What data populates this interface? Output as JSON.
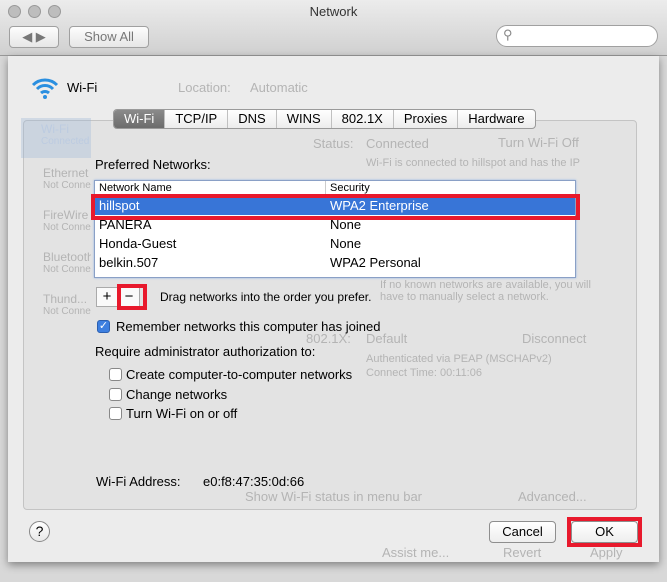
{
  "window": {
    "title": "Network",
    "show_all": "Show All",
    "search_placeholder": ""
  },
  "background": {
    "location_label": "Location:",
    "location_value": "Automatic",
    "status_label": "Status:",
    "status_value": "Connected",
    "turn_off": "Turn Wi-Fi Off",
    "status_desc": "Wi-Fi is connected to hillspot and has the IP",
    "eightoz_label": "802.1X:",
    "eightoz_value": "Default",
    "disconnect": "Disconnect",
    "auth": "Authenticated via PEAP (MSCHAPv2)",
    "connect_time": "Connect Time: 00:11:06",
    "known": "If no known networks are available, you will",
    "known2": "have to manually select a network.",
    "show_status": "Show Wi-Fi status in menu bar",
    "advanced": "Advanced...",
    "assist": "Assist me...",
    "revert": "Revert",
    "apply": "Apply",
    "services": [
      {
        "name": "Wi-Fi",
        "status": "Connected"
      },
      {
        "name": "Ethernet",
        "status": "Not Connected"
      },
      {
        "name": "FireWire",
        "status": "Not Connected"
      },
      {
        "name": "Bluetooth",
        "status": "Not Connected"
      },
      {
        "name": "Thund...",
        "status": "Not Connected"
      }
    ]
  },
  "sheet": {
    "header": "Wi-Fi",
    "tabs": [
      "Wi-Fi",
      "TCP/IP",
      "DNS",
      "WINS",
      "802.1X",
      "Proxies",
      "Hardware"
    ],
    "selected_tab": "Wi-Fi",
    "preferred_label": "Preferred Networks:",
    "columns": [
      "Network Name",
      "Security"
    ],
    "networks": [
      {
        "name": "hillspot",
        "security": "WPA2 Enterprise"
      },
      {
        "name": "PANERA",
        "security": "None"
      },
      {
        "name": "Honda-Guest",
        "security": "None"
      },
      {
        "name": "belkin.507",
        "security": "WPA2 Personal"
      }
    ],
    "selected_network": "hillspot",
    "add": "+",
    "remove": "−",
    "drag_hint": "Drag networks into the order you prefer.",
    "remember": {
      "label": "Remember networks this computer has joined",
      "checked": true
    },
    "require_label": "Require administrator authorization to:",
    "require_options": [
      {
        "label": "Create computer-to-computer networks",
        "checked": false
      },
      {
        "label": "Change networks",
        "checked": false
      },
      {
        "label": "Turn Wi-Fi on or off",
        "checked": false
      }
    ],
    "address_label": "Wi-Fi Address:",
    "address_value": "e0:f8:47:35:0d:66",
    "help": "?",
    "cancel": "Cancel",
    "ok": "OK"
  },
  "colors": {
    "selection": "#3875d7",
    "highlight": "#e8192c",
    "wifi": "#2a8fe0"
  }
}
